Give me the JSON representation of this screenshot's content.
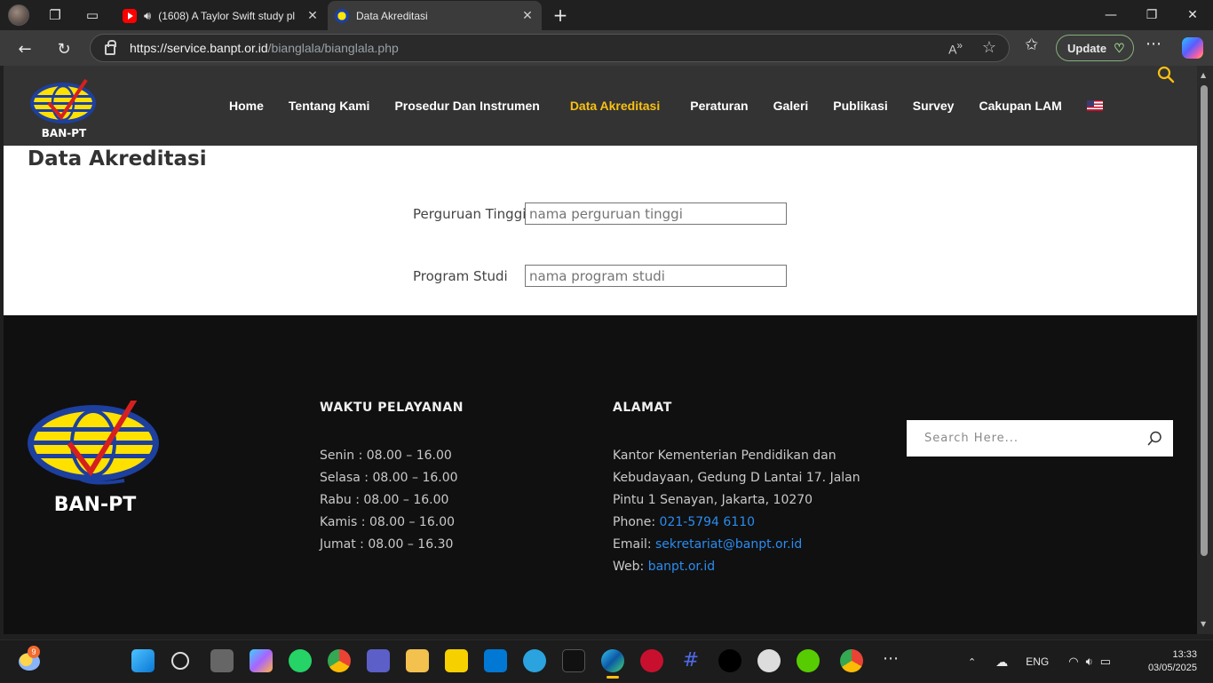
{
  "browser": {
    "tabs": [
      {
        "title": "(1608) A Taylor Swift study pl",
        "active": false,
        "audio": true
      },
      {
        "title": "Data Akreditasi",
        "active": true
      }
    ],
    "url_domain": "https://service.banpt.or.id",
    "url_path": "/bianglala/bianglala.php",
    "update_label": "Update"
  },
  "site": {
    "nav": [
      "Home",
      "Tentang Kami",
      "Prosedur Dan Instrumen",
      "Data Akreditasi",
      "Peraturan",
      "Galeri",
      "Publikasi",
      "Survey",
      "Cakupan LAM"
    ],
    "active_nav": "Data Akreditasi",
    "accent_color": "#f9c013",
    "logo_text": "BAN-PT"
  },
  "page": {
    "title": "Data Akreditasi",
    "form": {
      "pt_label": "Perguruan Tinggi",
      "pt_placeholder": "nama perguruan tinggi",
      "ps_label": "Program Studi",
      "ps_placeholder": "nama program studi"
    }
  },
  "footer": {
    "hours_heading": "WAKTU PELAYANAN",
    "hours": [
      "Senin : 08.00 – 16.00",
      "Selasa : 08.00 – 16.00",
      "Rabu : 08.00 – 16.00",
      "Kamis : 08.00 – 16.00",
      "Jumat : 08.00 – 16.30"
    ],
    "address_heading": "ALAMAT",
    "address_line1": "Kantor Kementerian Pendidikan dan",
    "address_line2": "Kebudayaan, Gedung D Lantai 17. Jalan",
    "address_line3": "Pintu 1 Senayan, Jakarta, 10270",
    "phone_label": "Phone:",
    "phone": "021-5794 6110",
    "email_label": "Email:",
    "email": "sekretariat@banpt.or.id",
    "web_label": "Web:",
    "web": "banpt.or.id",
    "search_placeholder": "Search Here..."
  },
  "taskbar": {
    "weather_badge": "9",
    "lang": "ENG",
    "time": "13:33",
    "date": "03/05/2025"
  }
}
